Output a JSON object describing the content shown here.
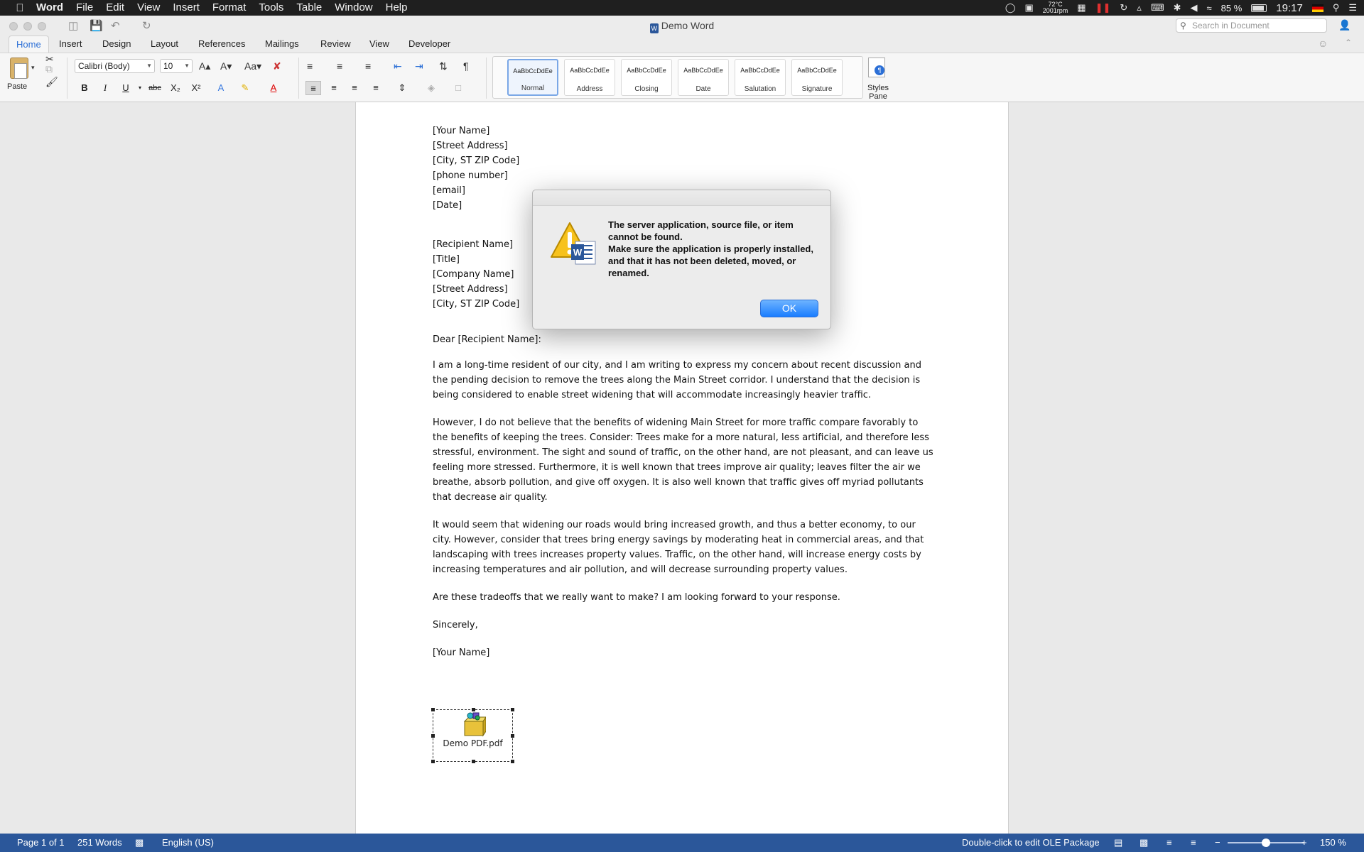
{
  "menubar": {
    "app_name": "Word",
    "items": [
      "File",
      "Edit",
      "View",
      "Insert",
      "Format",
      "Tools",
      "Table",
      "Window",
      "Help"
    ],
    "temperature": "72°C",
    "fan": "2001rpm",
    "battery": "85 %",
    "clock": "19:17"
  },
  "window": {
    "title": "Demo Word",
    "search_placeholder": "Search in Document"
  },
  "ribbon_tabs": [
    "Home",
    "Insert",
    "Design",
    "Layout",
    "References",
    "Mailings",
    "Review",
    "View",
    "Developer"
  ],
  "ribbon": {
    "paste_label": "Paste",
    "font_name": "Calibri (Body)",
    "font_size": "10",
    "styles": [
      {
        "preview": "AaBbCcDdEe",
        "name": "Normal"
      },
      {
        "preview": "AaBbCcDdEe",
        "name": "Address"
      },
      {
        "preview": "AaBbCcDdEe",
        "name": "Closing"
      },
      {
        "preview": "AaBbCcDdEe",
        "name": "Date"
      },
      {
        "preview": "AaBbCcDdEe",
        "name": "Salutation"
      },
      {
        "preview": "AaBbCcDdEe",
        "name": "Signature"
      }
    ],
    "styles_pane_label": "Styles Pane"
  },
  "document": {
    "sender": [
      "[Your Name]",
      "[Street Address]",
      "[City, ST ZIP Code]",
      "[phone number]",
      "[email]",
      "[Date]"
    ],
    "recipient": [
      "[Recipient Name]",
      "[Title]",
      "[Company Name]",
      "[Street Address]",
      "[City, ST ZIP Code]"
    ],
    "salutation": "Dear [Recipient Name]:",
    "paragraphs": [
      "I am a long-time resident of our city, and I am writing to express my concern about recent discussion and the pending decision to remove the trees along the Main Street corridor. I understand that the decision is being considered to enable street widening that will accommodate increasingly heavier traffic.",
      "However, I do not believe that the benefits of widening Main Street for more traffic compare favorably to the benefits of keeping the trees. Consider:  Trees make for a more natural, less artificial, and therefore less stressful, environment. The sight and sound of traffic, on the other hand, are not pleasant, and can leave us feeling more stressed. Furthermore, it is well known that trees improve air quality; leaves filter the air we breathe, absorb pollution, and give off oxygen. It is also well known that traffic gives off myriad pollutants that decrease air quality.",
      "It would seem that widening our roads would bring increased growth, and thus a better economy, to our city. However, consider that trees bring energy savings by moderating heat in commercial areas, and that landscaping with trees increases property values. Traffic, on the other hand, will increase energy costs by increasing temperatures and air pollution, and will decrease surrounding property values.",
      "Are these tradeoffs that we really want to make? I am looking forward to your response."
    ],
    "closing": "Sincerely,",
    "signature": "[Your Name]",
    "ole_caption": "Demo PDF.pdf"
  },
  "dialog": {
    "message_line1": "The server application, source file, or item cannot be found.",
    "message_line2": "Make sure the application is properly installed, and that it has not been deleted, moved, or renamed.",
    "ok_label": "OK"
  },
  "statusbar": {
    "page": "Page 1 of 1",
    "words": "251 Words",
    "language": "English (US)",
    "hint": "Double-click to edit OLE Package",
    "zoom": "150 %",
    "zoom_level": 0.5
  },
  "colors": {
    "status_bar": "#2b579a",
    "accent": "#2b6fd6",
    "ok_button": "#1a7dff"
  }
}
